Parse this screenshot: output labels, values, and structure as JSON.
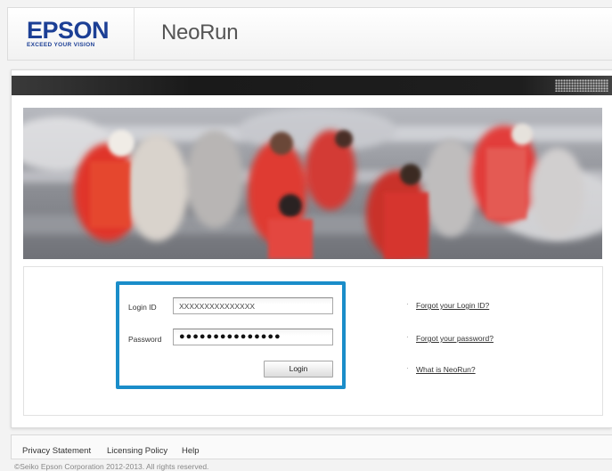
{
  "brand": {
    "logo_word": "EPSON",
    "logo_tagline": "EXCEED YOUR VISION",
    "app_title": "NeoRun",
    "color": "#1c3f95"
  },
  "login_form": {
    "login_id_label": "Login ID",
    "login_id_value": "XXXXXXXXXXXXXXX",
    "password_label": "Password",
    "password_value": "●●●●●●●●●●●●●●●",
    "login_button": "Login",
    "highlight_color": "#1a8dc9"
  },
  "side_links": [
    {
      "label": "Forgot your Login ID?"
    },
    {
      "label": "Forgot your password?"
    },
    {
      "label": "What is NeoRun?"
    }
  ],
  "footer": {
    "links": [
      "Privacy Statement",
      "Licensing Policy",
      "Help"
    ],
    "copyright": "©Seiko Epson Corporation 2012-2013. All rights reserved."
  }
}
